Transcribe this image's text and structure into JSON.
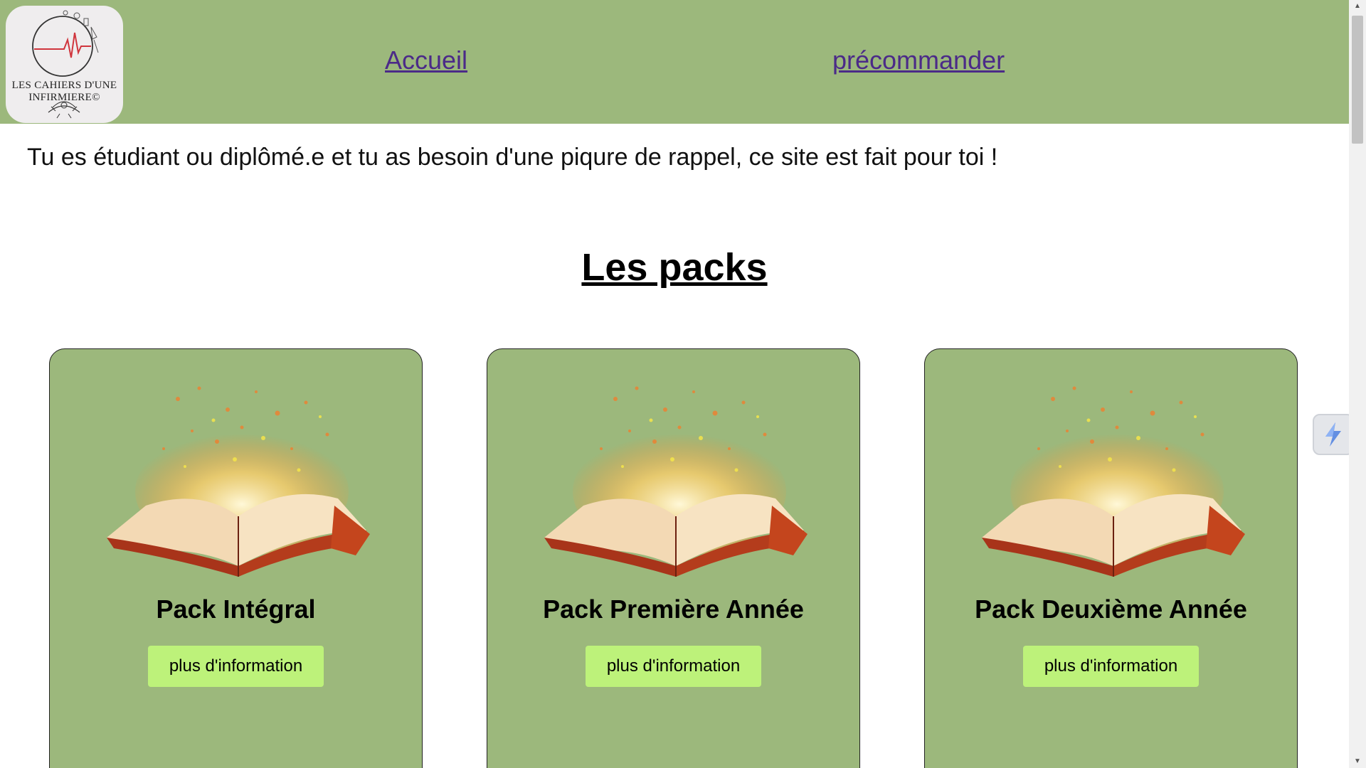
{
  "logo": {
    "line1": "LES CAHIERS D'UNE",
    "line2": "INFIRMIERE©",
    "icon": "heartbeat-stethoscope-logo"
  },
  "nav": {
    "home_label": "Accueil",
    "preorder_label": "précommander",
    "link_color": "#4b2a88"
  },
  "intro_text": "Tu es étudiant ou diplômé.e et tu as besoin d'une piqure de rappel, ce site est fait pour toi !",
  "section_title": "Les packs",
  "cards": [
    {
      "title": "Pack Intégral",
      "button_label": "plus d'information",
      "image": "magic-open-book-image"
    },
    {
      "title": "Pack Première Année",
      "button_label": "plus d'information",
      "image": "magic-open-book-image"
    },
    {
      "title": "Pack Deuxième Année",
      "button_label": "plus d'information",
      "image": "magic-open-book-image"
    }
  ],
  "colors": {
    "header_bg": "#9cb87c",
    "card_bg": "#9cb87c",
    "button_bg": "#bdf27a"
  },
  "floating_widget_icon": "lightning-icon"
}
